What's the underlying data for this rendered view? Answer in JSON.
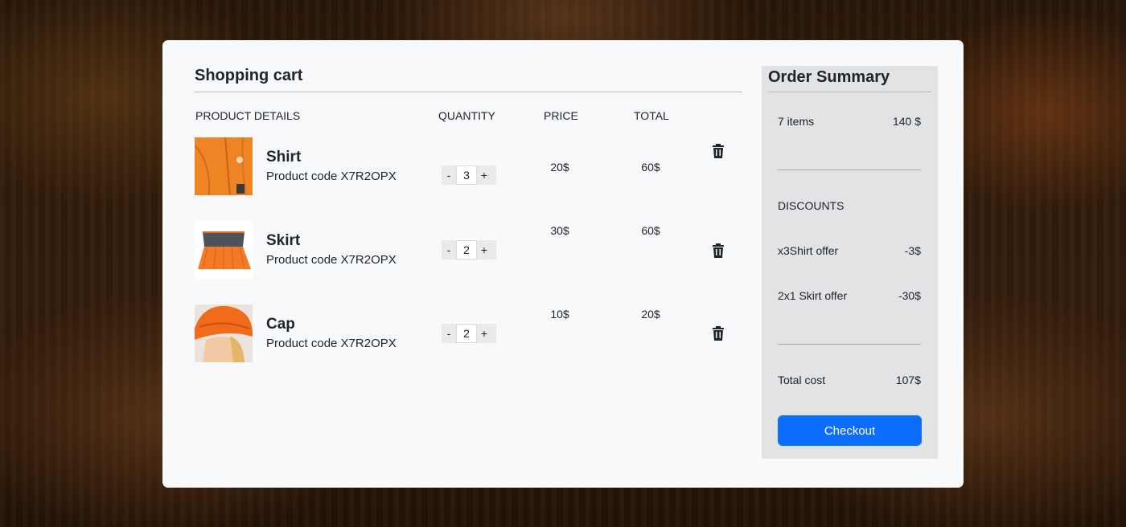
{
  "cart": {
    "title": "Shopping cart",
    "headers": {
      "product": "PRODUCT DETAILS",
      "quantity": "QUANTITY",
      "price": "PRICE",
      "total": "TOTAL"
    },
    "minus": "-",
    "plus": "+",
    "items": [
      {
        "name": "Shirt",
        "code": "Product code X7R2OPX",
        "quantity": "3",
        "price": "20$",
        "total": "60$"
      },
      {
        "name": "Skirt",
        "code": "Product code X7R2OPX",
        "quantity": "2",
        "price": "30$",
        "total": "60$"
      },
      {
        "name": "Cap",
        "code": "Product code X7R2OPX",
        "quantity": "2",
        "price": "10$",
        "total": "20$"
      }
    ]
  },
  "summary": {
    "title": "Order Summary",
    "items_label": "7 items",
    "items_value": "140 $",
    "discounts_label": "DISCOUNTS",
    "discounts": [
      {
        "label": "x3Shirt offer",
        "value": "-3$"
      },
      {
        "label": "2x1 Skirt offer",
        "value": "-30$"
      }
    ],
    "total_label": "Total cost",
    "total_value": "107$",
    "checkout": "Checkout"
  },
  "colors": {
    "accent": "#0d6efd",
    "card": "#f8f9fa",
    "summary": "#e2e3e5",
    "product_orange": "#f07a24"
  },
  "icons": [
    "trash-icon"
  ]
}
